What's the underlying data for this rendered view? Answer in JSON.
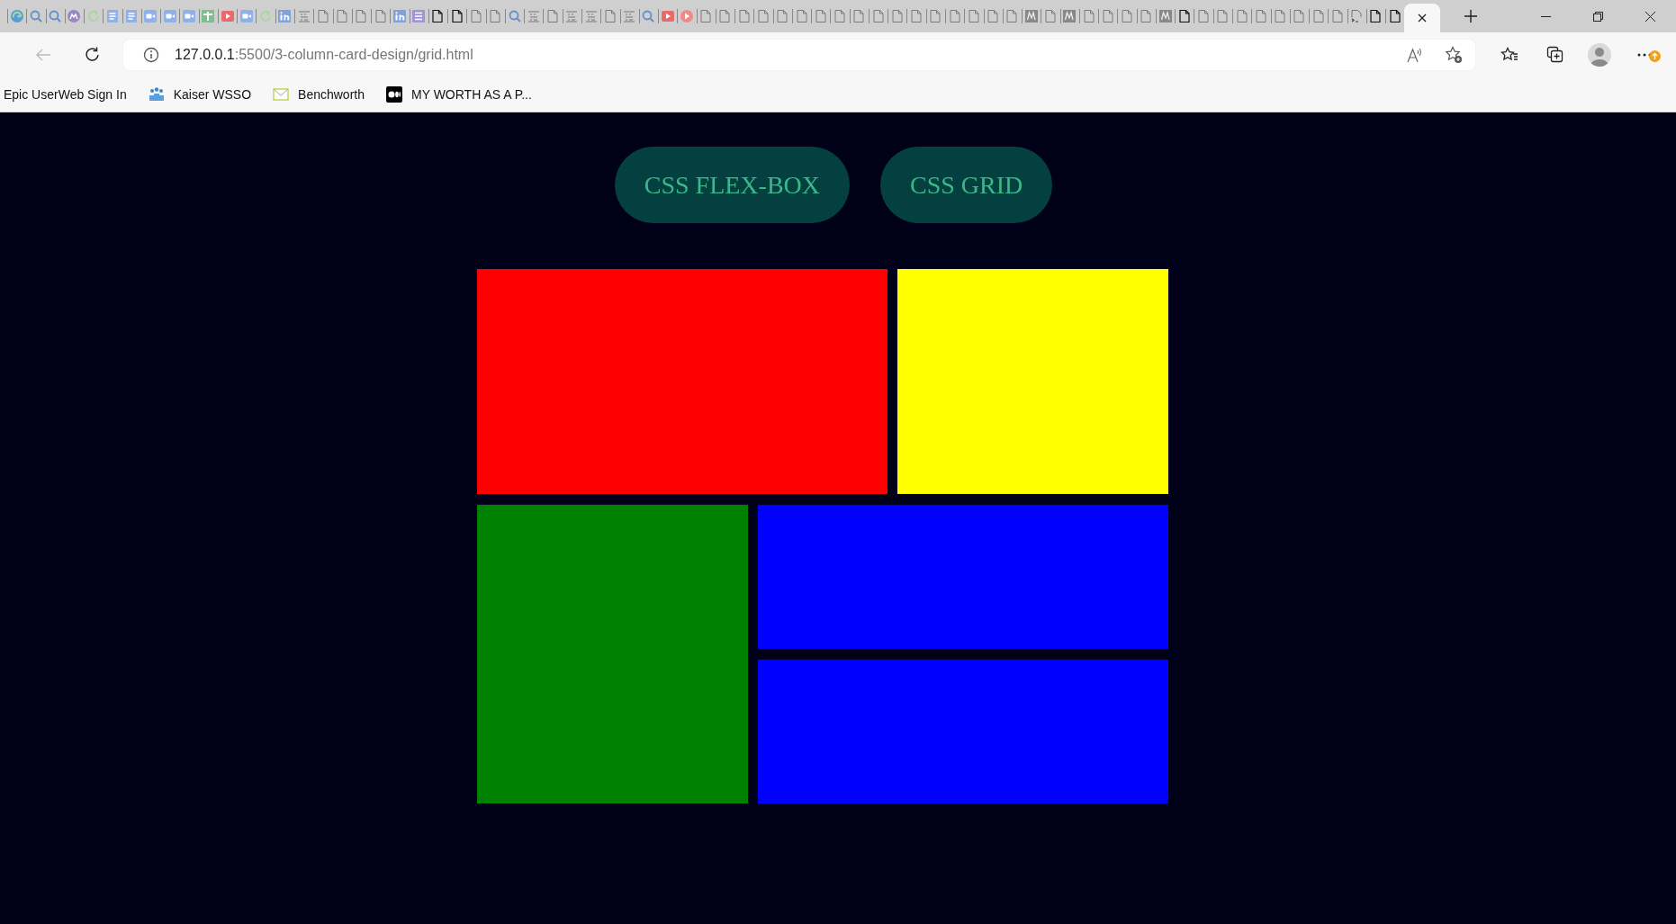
{
  "browser": {
    "tabs": [
      {
        "kind": "swirl",
        "selected": false
      },
      {
        "kind": "search",
        "selected": false
      },
      {
        "kind": "search",
        "selected": false
      },
      {
        "kind": "circle-logo",
        "selected": false
      },
      {
        "kind": "refresh",
        "selected": false
      },
      {
        "kind": "doc",
        "selected": false
      },
      {
        "kind": "doc",
        "selected": false
      },
      {
        "kind": "video",
        "selected": false
      },
      {
        "kind": "video",
        "selected": false
      },
      {
        "kind": "video",
        "selected": false
      },
      {
        "kind": "plus",
        "selected": false
      },
      {
        "kind": "play",
        "selected": false
      },
      {
        "kind": "video",
        "selected": false
      },
      {
        "kind": "refresh",
        "selected": false
      },
      {
        "kind": "in-logo",
        "selected": false
      },
      {
        "kind": "notes",
        "selected": false
      },
      {
        "kind": "page",
        "selected": false
      },
      {
        "kind": "page",
        "selected": false
      },
      {
        "kind": "page",
        "selected": false
      },
      {
        "kind": "page",
        "selected": false
      },
      {
        "kind": "in-logo",
        "selected": false
      },
      {
        "kind": "list",
        "selected": false
      },
      {
        "kind": "page-dark",
        "selected": false
      },
      {
        "kind": "page-dark",
        "selected": false
      },
      {
        "kind": "page",
        "selected": false
      },
      {
        "kind": "page",
        "selected": false
      },
      {
        "kind": "search",
        "selected": false
      },
      {
        "kind": "notes",
        "selected": false
      },
      {
        "kind": "page",
        "selected": false
      },
      {
        "kind": "notes",
        "selected": false
      },
      {
        "kind": "notes",
        "selected": false
      },
      {
        "kind": "page",
        "selected": false
      },
      {
        "kind": "notes",
        "selected": false
      },
      {
        "kind": "search",
        "selected": false
      },
      {
        "kind": "play",
        "selected": false
      },
      {
        "kind": "play-logo",
        "selected": false
      },
      {
        "kind": "page",
        "selected": false
      },
      {
        "kind": "page",
        "selected": false
      },
      {
        "kind": "page",
        "selected": false
      },
      {
        "kind": "page",
        "selected": false
      },
      {
        "kind": "page",
        "selected": false
      },
      {
        "kind": "page",
        "selected": false
      },
      {
        "kind": "page",
        "selected": false
      },
      {
        "kind": "page",
        "selected": false
      },
      {
        "kind": "page",
        "selected": false
      },
      {
        "kind": "page",
        "selected": false
      },
      {
        "kind": "page",
        "selected": false
      },
      {
        "kind": "page",
        "selected": false
      },
      {
        "kind": "page",
        "selected": false
      },
      {
        "kind": "page",
        "selected": false
      },
      {
        "kind": "page",
        "selected": false
      },
      {
        "kind": "page",
        "selected": false
      },
      {
        "kind": "page",
        "selected": false
      },
      {
        "kind": "m-logo",
        "selected": false
      },
      {
        "kind": "page",
        "selected": false
      },
      {
        "kind": "m-logo",
        "selected": false
      },
      {
        "kind": "page",
        "selected": false
      },
      {
        "kind": "page",
        "selected": false
      },
      {
        "kind": "page",
        "selected": false
      },
      {
        "kind": "page",
        "selected": false
      },
      {
        "kind": "m-logo",
        "selected": false
      },
      {
        "kind": "page-dark",
        "selected": false
      },
      {
        "kind": "page",
        "selected": false
      },
      {
        "kind": "page",
        "selected": false
      },
      {
        "kind": "page",
        "selected": false
      },
      {
        "kind": "page",
        "selected": false
      },
      {
        "kind": "page",
        "selected": false
      },
      {
        "kind": "page",
        "selected": false
      },
      {
        "kind": "page",
        "selected": false
      },
      {
        "kind": "page",
        "selected": false
      },
      {
        "kind": "script",
        "selected": false
      },
      {
        "kind": "page-dark",
        "selected": false
      },
      {
        "kind": "page-dark",
        "selected": false
      },
      {
        "kind": "active",
        "selected": true
      }
    ],
    "back_button": {
      "disabled": true
    },
    "address": {
      "host": "127.0.0.1",
      "path": ":5500/3-column-card-design/grid.html"
    },
    "menu": {
      "update_badge": true
    },
    "bookmarks": [
      {
        "label": "Epic UserWeb Sign In",
        "kind": "plain"
      },
      {
        "label": "Kaiser WSSO",
        "kind": "people"
      },
      {
        "label": "Benchworth",
        "kind": "mail"
      },
      {
        "label": "MY WORTH AS A P...",
        "kind": "dots"
      }
    ]
  },
  "page": {
    "nav_buttons": [
      "CSS FLEX-BOX",
      "CSS GRID"
    ],
    "blocks": [
      {
        "color": "#ff0000"
      },
      {
        "color": "#ffff00"
      },
      {
        "color": "#008000"
      },
      {
        "color": "#0000ff"
      },
      {
        "color": "#0000ff"
      }
    ]
  }
}
